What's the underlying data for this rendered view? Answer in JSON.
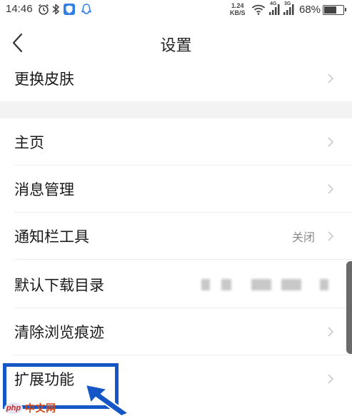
{
  "status_bar": {
    "time": "14:46",
    "net_speed_value": "1.24",
    "net_speed_unit": "KB/S",
    "signal_1_label": "4G",
    "signal_2_label": "3G",
    "battery_text": "68%",
    "battery_level": 0.68
  },
  "header": {
    "title": "设置"
  },
  "rows": [
    {
      "label": "更换皮肤"
    },
    {
      "label": "主页"
    },
    {
      "label": "消息管理"
    },
    {
      "label": "通知栏工具",
      "value": "关闭"
    },
    {
      "label": "默认下载目录"
    },
    {
      "label": "清除浏览痕迹"
    },
    {
      "label": "扩展功能"
    }
  ],
  "watermark": {
    "logo": "php",
    "text": "中文网"
  },
  "colors": {
    "highlight": "#1456c6",
    "divider": "#ececec",
    "section_gap": "#f3f3f3",
    "value_text": "#8a8a8a"
  }
}
